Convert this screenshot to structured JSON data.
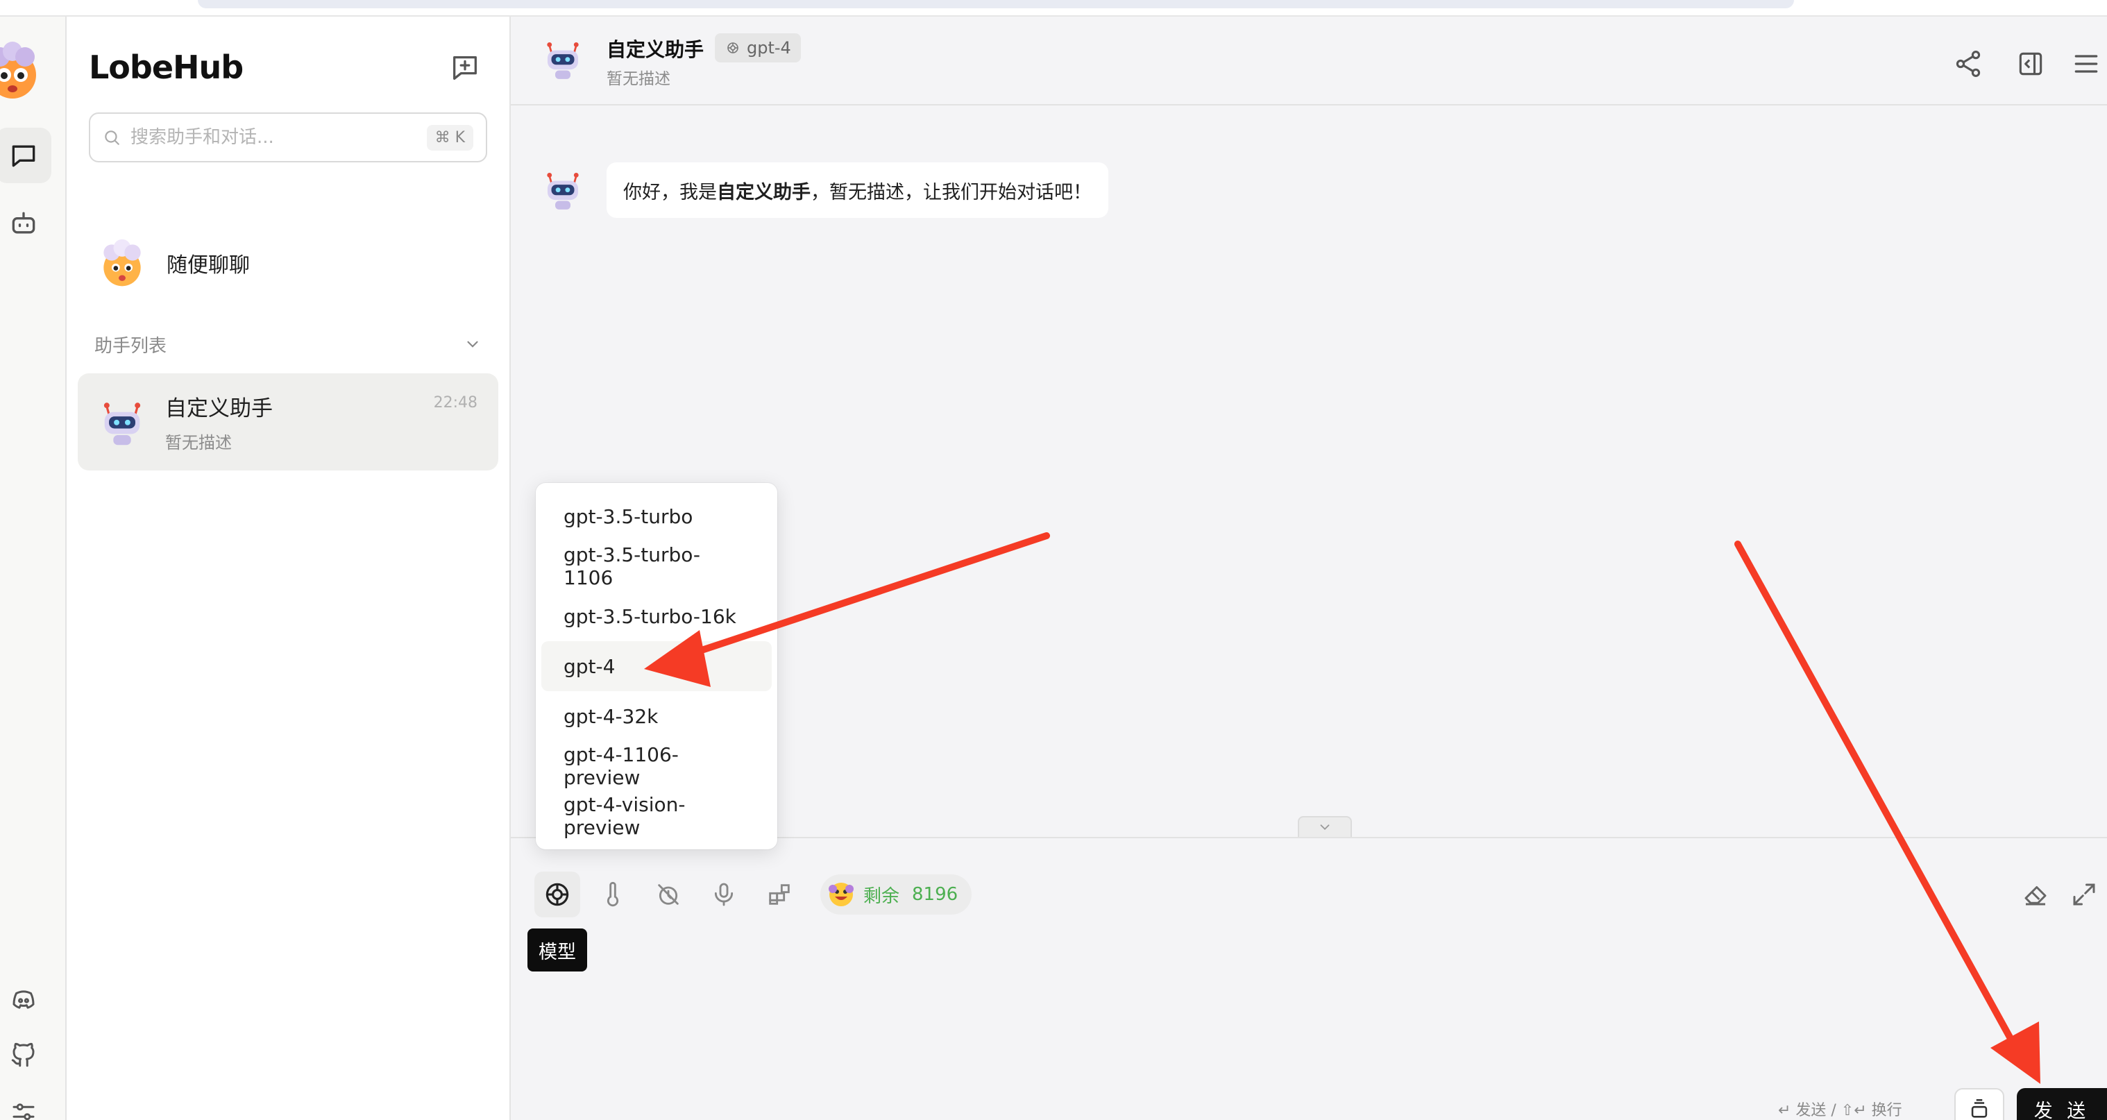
{
  "brand": "LobeHub",
  "search": {
    "placeholder": "搜索助手和对话...",
    "shortcut": "⌘ K"
  },
  "sessions": {
    "random": {
      "name": "随便聊聊"
    },
    "group_label": "助手列表",
    "items": [
      {
        "title": "自定义助手",
        "desc": "暂无描述",
        "time": "22:48"
      }
    ]
  },
  "header": {
    "title": "自定义助手",
    "model": "gpt-4",
    "desc": "暂无描述"
  },
  "message": {
    "prefix": "你好，我是 ",
    "name": "自定义助手",
    "suffix": "，暂无描述，让我们开始对话吧！"
  },
  "model_menu": {
    "items": [
      "gpt-3.5-turbo",
      "gpt-3.5-turbo-1106",
      "gpt-3.5-turbo-16k",
      "gpt-4",
      "gpt-4-32k",
      "gpt-4-1106-preview",
      "gpt-4-vision-preview"
    ],
    "selected": "gpt-4"
  },
  "toolbar": {
    "tooltip": "模型",
    "token_label": "剩余",
    "token_count": "8196"
  },
  "input": {
    "send_hint": "↵ 发送 / ⇧↵ 换行",
    "send_label": "发 送"
  },
  "colors": {
    "accent": "#111111",
    "token_green": "#4caf50",
    "annotation_arrow": "#f53b25"
  },
  "icons": {
    "rail": [
      "user-avatar",
      "chat-icon",
      "robot-icon",
      "discord-icon",
      "github-icon",
      "settings-icon"
    ],
    "header_actions": [
      "share-icon",
      "panel-toggle-icon",
      "menu-icon"
    ],
    "tools": [
      "model-brain-icon",
      "temperature-icon",
      "history-off-icon",
      "microphone-icon",
      "plugin-icon"
    ],
    "input_actions": [
      "eraser-icon",
      "expand-icon",
      "stack-icon"
    ]
  }
}
